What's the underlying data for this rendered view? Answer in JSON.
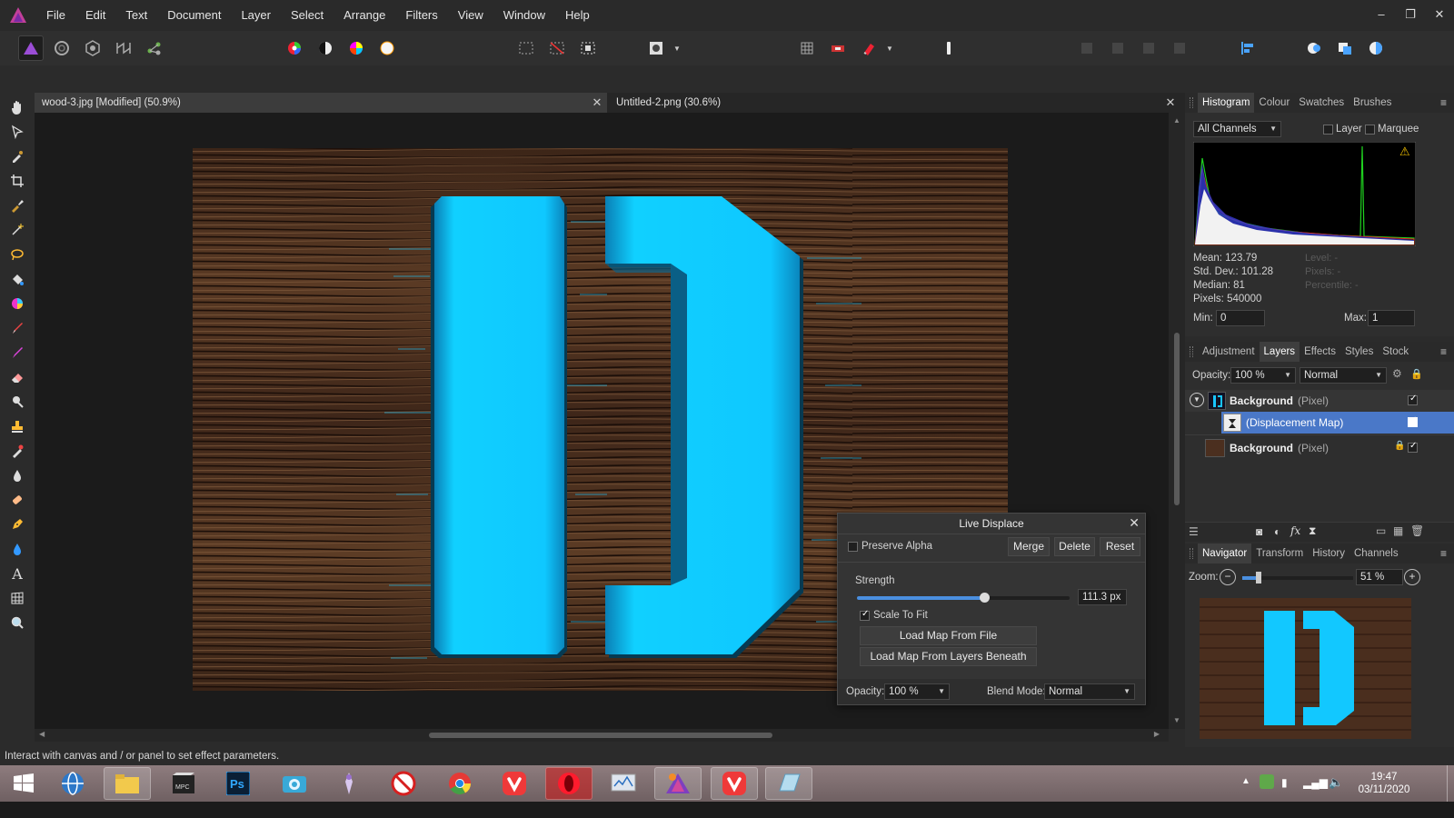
{
  "menu": {
    "items": [
      "File",
      "Edit",
      "Text",
      "Document",
      "Layer",
      "Select",
      "Arrange",
      "Filters",
      "View",
      "Window",
      "Help"
    ],
    "window_controls": [
      "–",
      "❐",
      "✕"
    ]
  },
  "documents": {
    "tabs": [
      {
        "label": "wood-3.jpg [Modified] (50.9%)",
        "active": true
      },
      {
        "label": "Untitled-2.png (30.6%)",
        "active": false
      }
    ],
    "close_glyph": "✕"
  },
  "histogram": {
    "tabs": [
      "Histogram",
      "Colour",
      "Swatches",
      "Brushes"
    ],
    "channel": "All Channels",
    "layer_label": "Layer",
    "marquee_label": "Marquee",
    "stats": [
      "Mean: 123.79",
      "Std. Dev.: 101.28",
      "Median: 81",
      "Pixels: 540000"
    ],
    "stats_dim": [
      "Level: -",
      "Pixels: -",
      "Percentile: -"
    ],
    "min_label": "Min:",
    "min_value": "0",
    "max_label": "Max:",
    "max_value": "1",
    "warning_icon": "⚠"
  },
  "layers": {
    "tabs": [
      "Adjustment",
      "Layers",
      "Effects",
      "Styles",
      "Stock"
    ],
    "opacity_label": "Opacity:",
    "opacity_value": "100 %",
    "blend_mode": "Normal",
    "rows": [
      {
        "name": "Background",
        "type": "(Pixel)",
        "selected": false
      },
      {
        "name": "(Displacement Map)",
        "type": "",
        "selected": true
      },
      {
        "name": "Background",
        "type": "(Pixel)",
        "selected": false
      }
    ]
  },
  "navigator": {
    "tabs": [
      "Navigator",
      "Transform",
      "History",
      "Channels"
    ],
    "zoom_label": "Zoom:",
    "zoom_value": "51 %",
    "zoom_fraction": 0.12
  },
  "live_displace": {
    "title": "Live Displace",
    "preserve_alpha": "Preserve Alpha",
    "merge": "Merge",
    "delete": "Delete",
    "reset": "Reset",
    "strength_label": "Strength",
    "strength_value": "111.3 px",
    "strength_fraction": 0.6,
    "scale_to_fit": "Scale To Fit",
    "load_file": "Load Map From File",
    "load_layers": "Load Map From Layers Beneath",
    "opacity_label": "Opacity:",
    "opacity_value": "100 %",
    "blend_label": "Blend Mode:",
    "blend_value": "Normal"
  },
  "status": {
    "text": "Interact with canvas and / or panel to set effect parameters."
  },
  "taskbar": {
    "time": "19:47",
    "date": "03/11/2020"
  },
  "colors": {
    "accent_blue": "#00c8ff",
    "selection": "#4a78c8",
    "wood_dark": "#3a2418"
  }
}
